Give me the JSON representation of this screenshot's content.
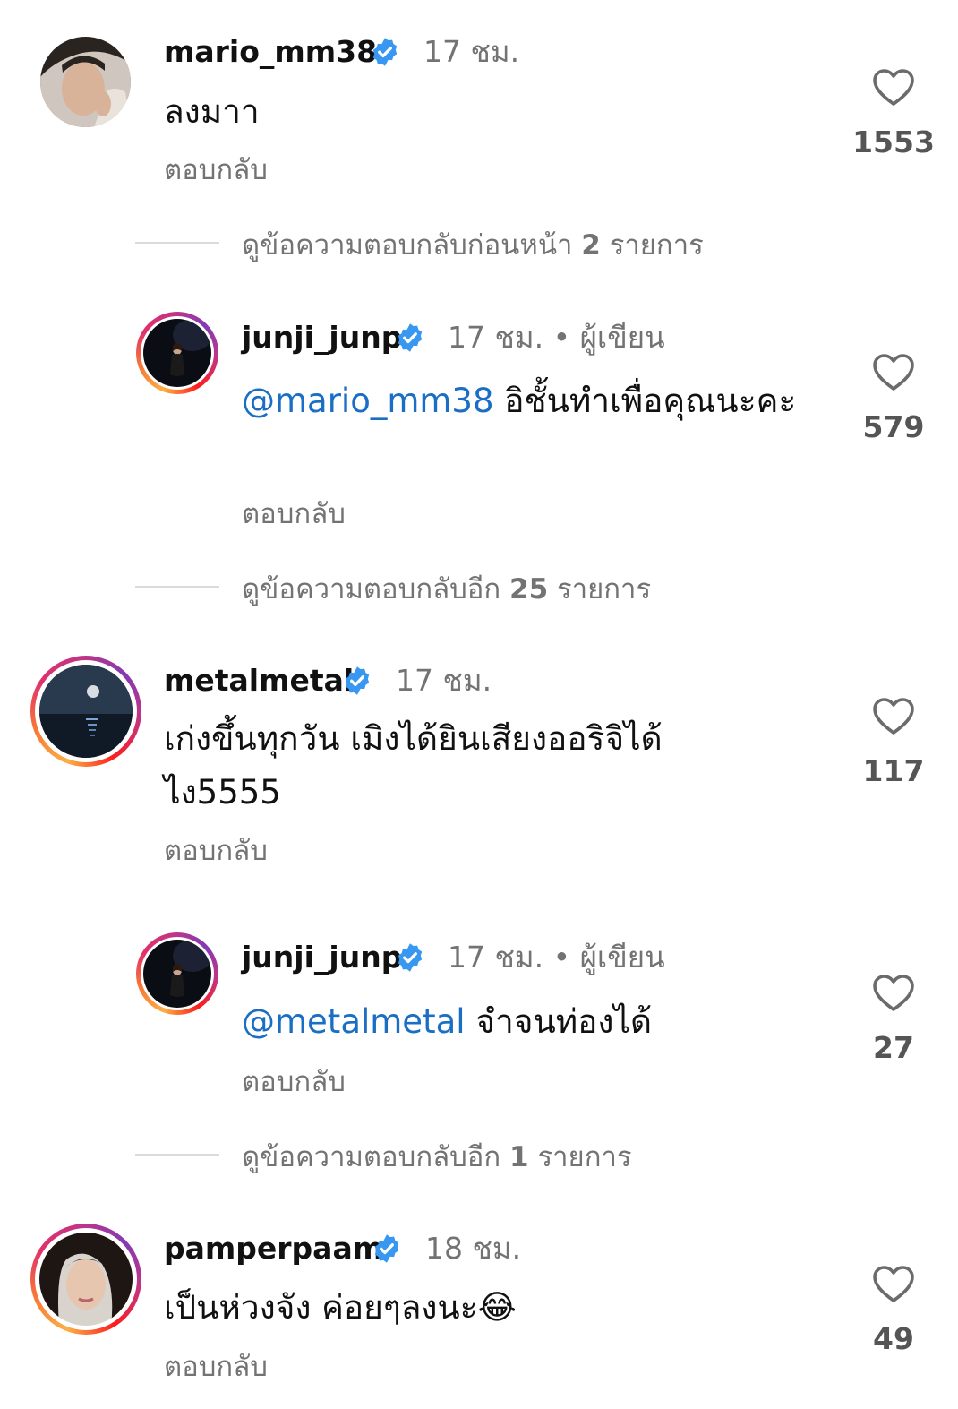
{
  "comments": [
    {
      "username": "mario_mm38",
      "time": "17 ชม.",
      "text": "ลงมาา",
      "reply_label": "ตอบกลับ",
      "likes": "1553",
      "avatar": "photo-man"
    },
    {
      "username": "junji_junp",
      "time": "17 ชม.",
      "author_tag": "• ผู้เขียน",
      "mention": "@mario_mm38",
      "text": " อิชั้นทำเพื่อคุณนะคะ",
      "reply_label": "ตอบกลับ",
      "likes": "579",
      "avatar": "photo-woman-dark"
    },
    {
      "username": "metalmetal",
      "time": "17 ชม.",
      "text": "เก่งขึ้นทุกวัน เมิงได้ยินเสียงออริจิได้ไง5555",
      "reply_label": "ตอบกลับ",
      "likes": "117",
      "avatar": "photo-moon-sea"
    },
    {
      "username": "junji_junp",
      "time": "17 ชม.",
      "author_tag": "• ผู้เขียน",
      "mention": "@metalmetal",
      "text": " จำจนท่องได้",
      "reply_label": "ตอบกลับ",
      "likes": "27",
      "avatar": "photo-woman-dark"
    },
    {
      "username": "pamperpaam",
      "time": "18 ชม.",
      "text": "เป็นห่วงจัง ค่อยๆลงนะ😂",
      "reply_label": "ตอบกลับ",
      "likes": "49",
      "avatar": "photo-woman"
    }
  ],
  "more_replies": [
    {
      "prefix": "ดูข้อความตอบกลับก่อนหน้า ",
      "count": "2",
      "suffix": " รายการ"
    },
    {
      "prefix": "ดูข้อความตอบกลับอีก ",
      "count": "25",
      "suffix": " รายการ"
    },
    {
      "prefix": "ดูข้อความตอบกลับอีก ",
      "count": "1",
      "suffix": " รายการ"
    }
  ],
  "colors": {
    "verified_blue": "#3897f0",
    "mention_blue": "#1a6fc4",
    "muted_gray": "#737373",
    "story_ring": "#e1306c"
  },
  "icons": {
    "verified": "verified-badge-icon",
    "like": "heart-outline-icon"
  }
}
